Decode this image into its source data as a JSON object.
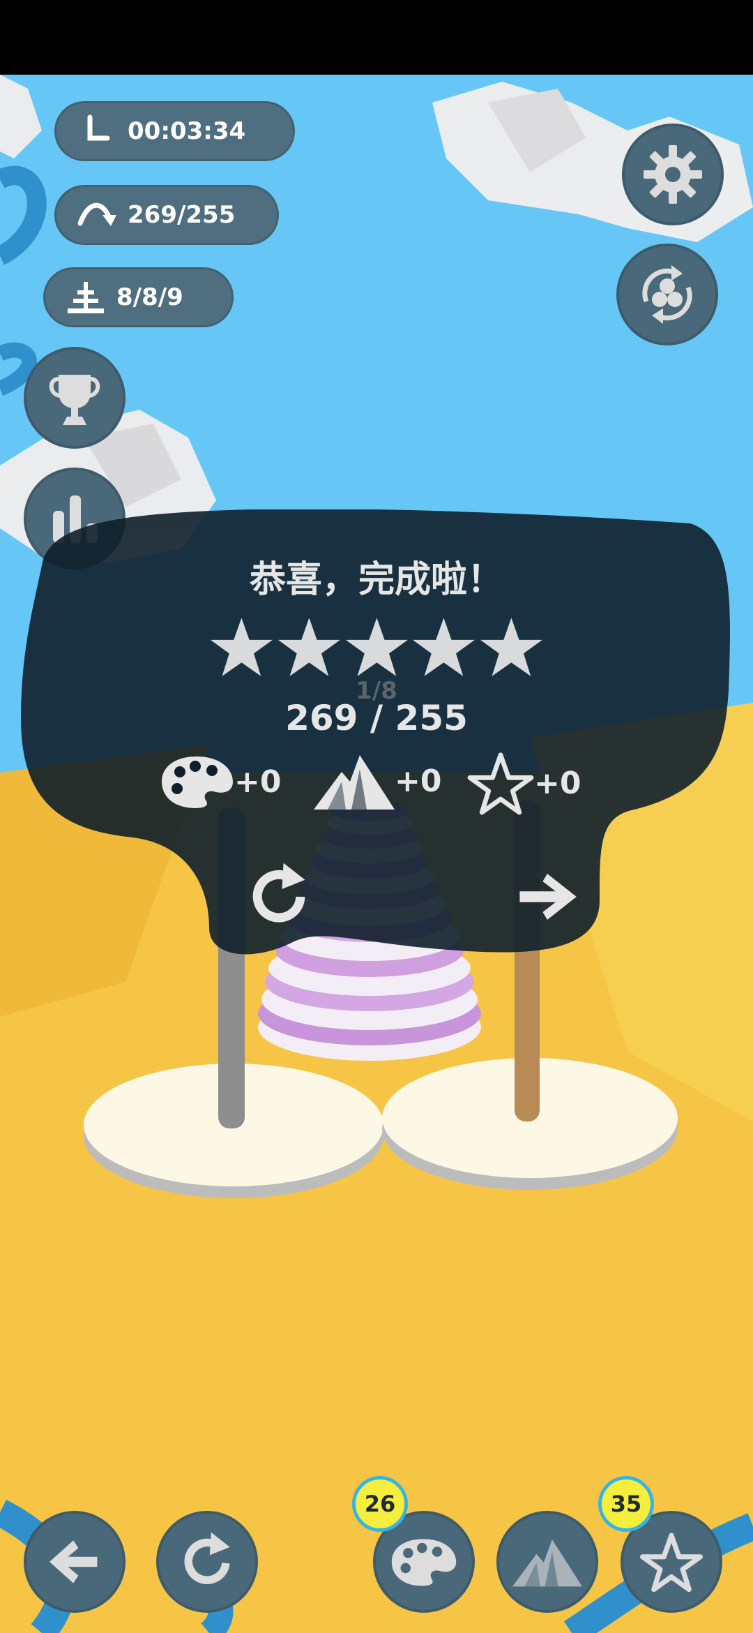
{
  "hud": {
    "timer": "00:03:34",
    "moves": "269/255",
    "level": "8/8/9"
  },
  "result": {
    "title": "恭喜，完成啦！",
    "stars": 5,
    "score": "269 / 255",
    "rewards": [
      {
        "icon": "palette-icon",
        "text": "+0"
      },
      {
        "icon": "mountain-icon",
        "text": "+0"
      },
      {
        "icon": "star-outline-icon",
        "text": "+0"
      }
    ],
    "ghost_label": "1/8"
  },
  "bottom": {
    "palette_count": "26",
    "star_count": "35"
  },
  "colors": {
    "sky": "#66c7f7",
    "ground": "#f6c545",
    "button": "#49697a",
    "ring": "#cf9fe0",
    "badge": "#f5ee3d"
  }
}
